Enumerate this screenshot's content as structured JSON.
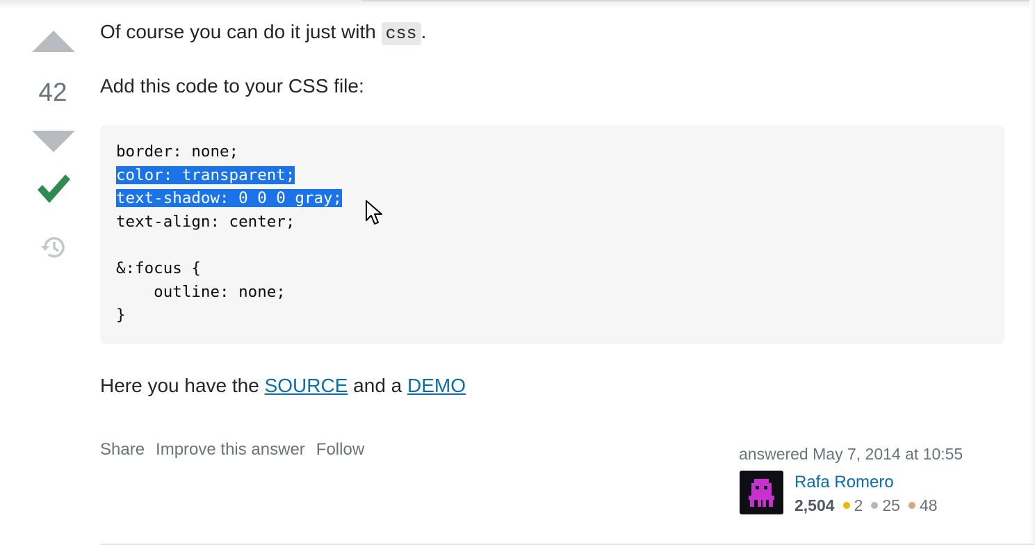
{
  "vote": {
    "count": "42"
  },
  "answer": {
    "p1_before": "Of course you can do it just with ",
    "p1_code": "css",
    "p1_after": ".",
    "p2": "Add this code to your CSS file:",
    "code_lines": [
      {
        "text": "border: none;",
        "selected": false
      },
      {
        "text": "color: transparent;",
        "selected": true
      },
      {
        "text": "text-shadow: 0 0 0 gray;",
        "selected": true
      },
      {
        "text": "text-align: center;",
        "selected": false
      },
      {
        "text": "",
        "selected": false
      },
      {
        "text": "&:focus {",
        "selected": false
      },
      {
        "text": "    outline: none;",
        "selected": false
      },
      {
        "text": "}",
        "selected": false
      }
    ],
    "p3_before": "Here you have the ",
    "source_link": "SOURCE",
    "p3_mid": " and a ",
    "demo_link": "DEMO"
  },
  "post_menu": {
    "share": "Share",
    "improve": "Improve this answer",
    "follow": "Follow"
  },
  "user_card": {
    "answered": "answered May 7, 2014 at 10:55",
    "name": "Rafa Romero",
    "reputation": "2,504",
    "gold": "2",
    "silver": "25",
    "bronze": "48"
  },
  "colors": {
    "accepted": "#2f8b52",
    "link": "#0c6ea8",
    "selection": "#1a73e8",
    "gold": "#f1b600",
    "silver": "#b4b8bc",
    "bronze": "#d1a684",
    "avatar_figure": "#c930d0"
  },
  "icons": [
    "vote-up-icon",
    "vote-down-icon",
    "accepted-check-icon",
    "history-icon",
    "mouse-cursor-icon"
  ]
}
